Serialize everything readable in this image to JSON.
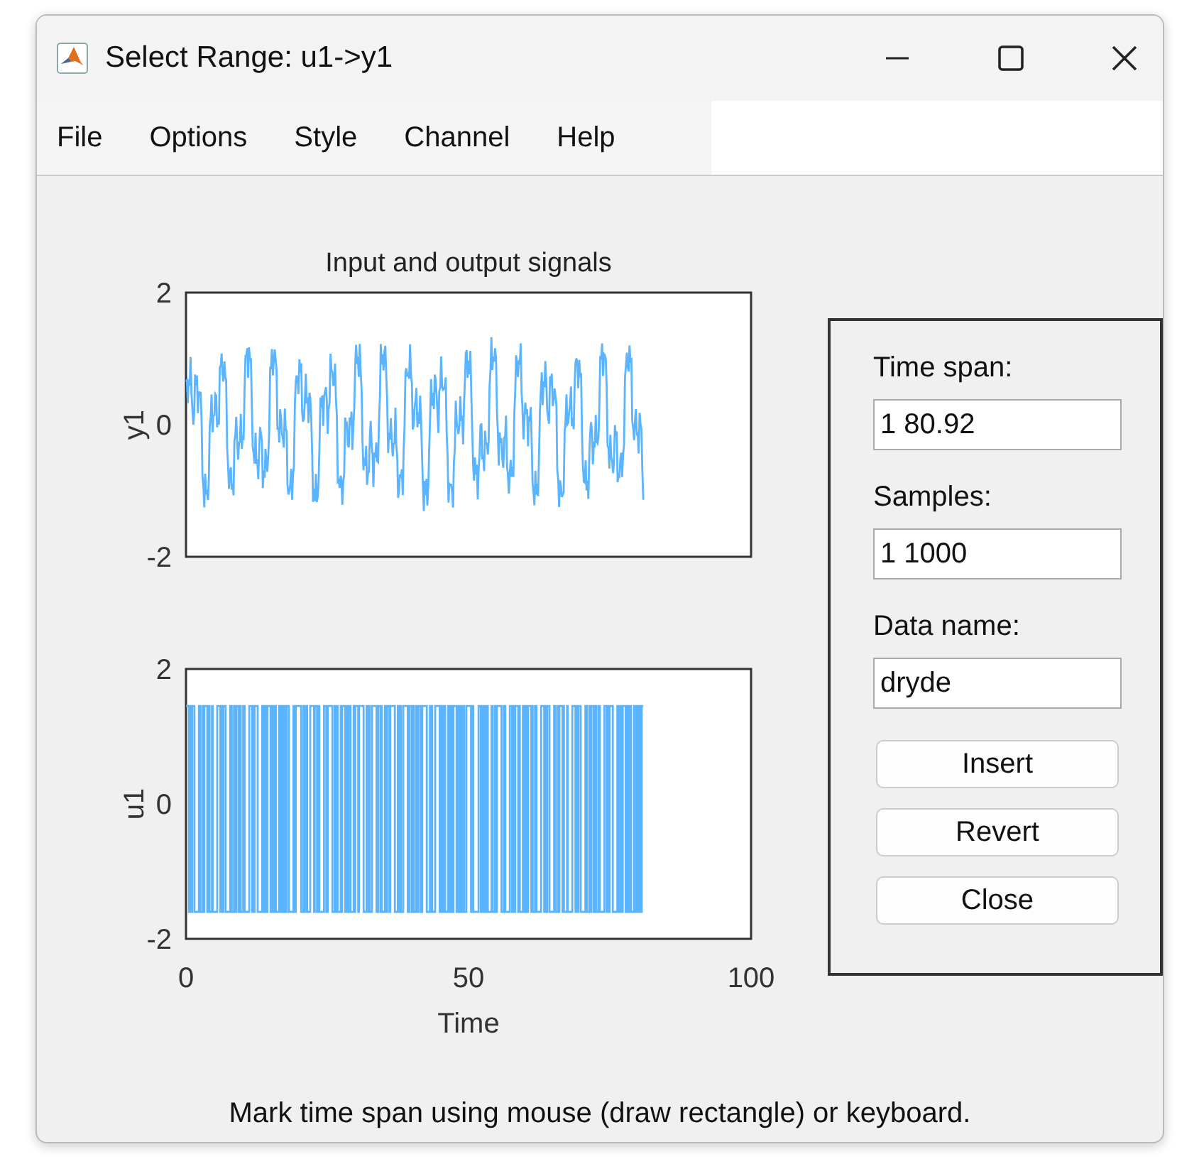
{
  "window": {
    "title": "Select Range: u1->y1"
  },
  "menu": [
    "File",
    "Options",
    "Style",
    "Channel",
    "Help"
  ],
  "plots": [
    {
      "kind": "output",
      "title": "Input and output signals",
      "ylabel": "y1",
      "yticks": [
        "2",
        "0",
        "-2"
      ]
    },
    {
      "kind": "input",
      "ylabel": "u1",
      "yticks": [
        "2",
        "0",
        "-2"
      ],
      "xticks": [
        "0",
        "50",
        "100"
      ],
      "xlabel": "Time"
    }
  ],
  "panel": {
    "fields": [
      {
        "label": "Time span:",
        "value": "1 80.92"
      },
      {
        "label": "Samples:",
        "value": "1 1000"
      },
      {
        "label": "Data name:",
        "value": "dryde"
      }
    ],
    "buttons": [
      "Insert",
      "Revert",
      "Close"
    ]
  },
  "status": "Mark time span using mouse (draw rectangle) or keyboard."
}
